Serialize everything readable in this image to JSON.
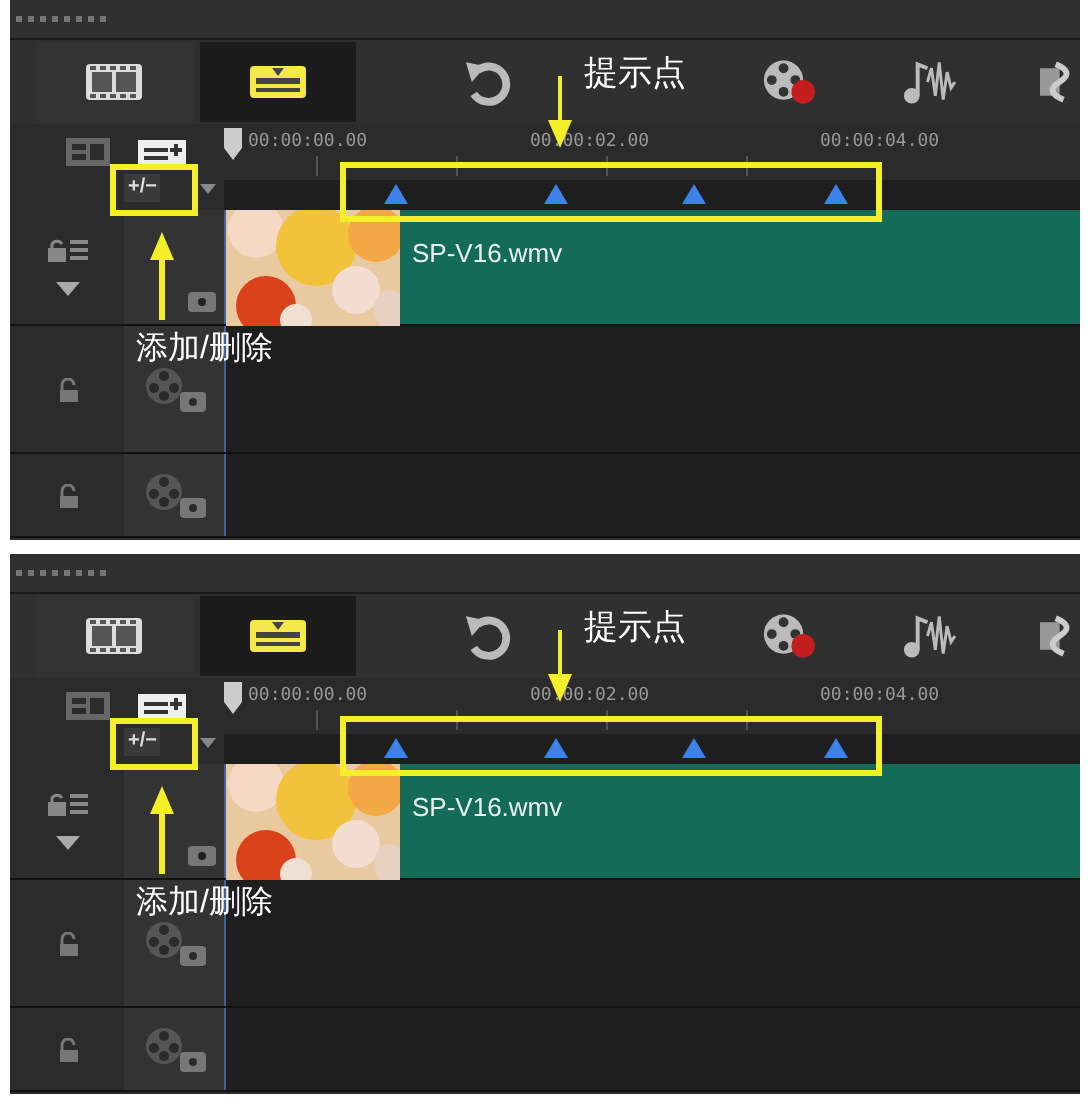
{
  "panels": [
    {
      "toolbar": [
        {
          "kind": "storyboard",
          "selected": false
        },
        {
          "kind": "timeline",
          "selected": true
        }
      ],
      "ruler": {
        "timestamps": [
          "00:00:00.00",
          "00:00:02.00",
          "00:00:04.00"
        ],
        "add_remove_button": "+/−"
      },
      "clip": {
        "name": "SP-V16.wmv"
      },
      "callouts": [
        {
          "kind": "top",
          "text": "提示点"
        },
        {
          "kind": "left",
          "text": "添加/删除"
        }
      ]
    },
    {
      "toolbar": [
        {
          "kind": "storyboard",
          "selected": false
        },
        {
          "kind": "timeline",
          "selected": true
        }
      ],
      "ruler": {
        "timestamps": [
          "00:00:00.00",
          "00:00:02.00",
          "00:00:04.00"
        ],
        "add_remove_button": "+/−"
      },
      "clip": {
        "name": "SP-V16.wmv"
      },
      "callouts": [
        {
          "kind": "top",
          "text": "提示点"
        },
        {
          "kind": "left",
          "text": "添加/删除"
        }
      ]
    }
  ]
}
